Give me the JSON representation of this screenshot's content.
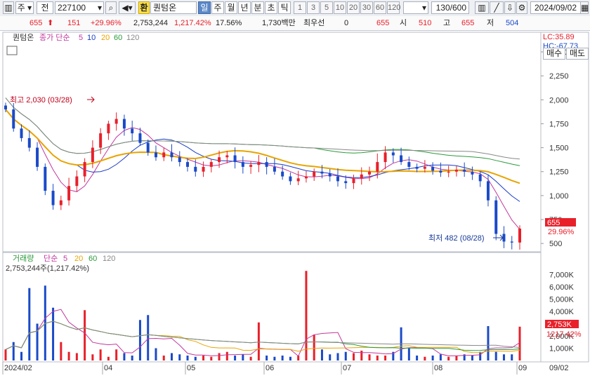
{
  "toolbar": {
    "period_short": "주",
    "prev_label": "전",
    "stock_code": "227100",
    "currency_label": "환",
    "stock_name": "퀀텀온",
    "tabs": [
      "일",
      "주",
      "월",
      "년",
      "분",
      "초",
      "틱"
    ],
    "active_tab": "일",
    "interval_buttons": [
      "1",
      "3",
      "5",
      "10",
      "20",
      "30",
      "60",
      "120"
    ],
    "count_display": "130/600",
    "date": "2024/09/02"
  },
  "info": {
    "price": "655",
    "change": "151",
    "change_pct": "+29.96%",
    "volume": "2,753,244",
    "volume_ratio": "1,217.42%",
    "turnover_pct": "17.56%",
    "amount": "1,730백만",
    "best_ask_label": "최우선",
    "best_ask_value": "0",
    "last": "655",
    "open_label": "시",
    "open": "510",
    "high_label": "고",
    "high": "655",
    "low_label": "저",
    "low": "504"
  },
  "price_panel": {
    "name_label": "퀀텀온",
    "ma_label": "종가 단순",
    "ma_periods": [
      "5",
      "10",
      "20",
      "60",
      "120"
    ],
    "lc": "LC:35.89",
    "hc": "HC:-67.73",
    "buy_button": "매수",
    "sell_button": "매도",
    "high_annotation": "최고 2,030 (03/28)",
    "low_annotation": "최저 482 (08/28)",
    "current_price_tag": "655",
    "current_pct_tag": "29.96%",
    "y_ticks": [
      "2,500",
      "2,250",
      "2,000",
      "1,750",
      "1,500",
      "1,250",
      "1,000",
      "750",
      "500"
    ]
  },
  "volume_panel": {
    "title": "거래량",
    "ma_label": "단순",
    "ma_periods": [
      "5",
      "20",
      "60",
      "120"
    ],
    "summary": "2,753,244주(1,217.42%)",
    "current_tag": "2,753K",
    "pct_tag": "1217.42%",
    "y_ticks": [
      "7,000K",
      "6,000K",
      "5,000K",
      "4,000K",
      "3,000K",
      "2,000K",
      "1,000K"
    ]
  },
  "x_axis": {
    "labels": [
      "2024/02",
      "04",
      "05",
      "06",
      "07",
      "08",
      "09"
    ],
    "right_label": "09/02"
  },
  "colors": {
    "up": "#e8202a",
    "down": "#1a4ac8",
    "ma5": "#c2389e",
    "ma10": "#1a3cc8",
    "ma20": "#e8a400",
    "ma60": "#2a9a3a",
    "ma120": "#888888"
  },
  "chart_data": {
    "type": "candlestick",
    "x_range": [
      "2024/02",
      "2024/09/02"
    ],
    "y_range_price": [
      450,
      2500
    ],
    "y_range_volume": [
      0,
      8000000
    ],
    "series": [
      {
        "name": "종가 단순 5"
      },
      {
        "name": "10"
      },
      {
        "name": "20"
      },
      {
        "name": "60"
      },
      {
        "name": "120"
      }
    ],
    "annotations": [
      {
        "label": "최고 2,030 (03/28)",
        "value": 2030
      },
      {
        "label": "최저 482 (08/28)",
        "value": 482
      }
    ],
    "close_path": [
      1900,
      1700,
      1600,
      1500,
      1300,
      1050,
      900,
      950,
      1100,
      1200,
      1350,
      1500,
      1650,
      1750,
      1800,
      1700,
      1650,
      1550,
      1450,
      1400,
      1450,
      1400,
      1350,
      1300,
      1250,
      1300,
      1350,
      1400,
      1420,
      1350,
      1300,
      1320,
      1350,
      1300,
      1250,
      1200,
      1150,
      1180,
      1200,
      1250,
      1230,
      1200,
      1150,
      1130,
      1180,
      1220,
      1250,
      1350,
      1450,
      1420,
      1350,
      1300,
      1280,
      1300,
      1260,
      1240,
      1250,
      1270,
      1250,
      1220,
      1150,
      950,
      600,
      520,
      510,
      655
    ],
    "volume_bars": [
      900000,
      1500000,
      700000,
      5900000,
      3000000,
      6100000,
      4300000,
      1500000,
      700000,
      600000,
      4100000,
      500000,
      900000,
      300000,
      900000,
      600000,
      400000,
      3300000,
      3700000,
      1000000,
      400000,
      600000,
      500000,
      400000,
      300000,
      400000,
      300000,
      600000,
      700000,
      400000,
      500000,
      300000,
      3100000,
      400000,
      300000,
      400000,
      300000,
      400000,
      7300000,
      2100000,
      900000,
      500000,
      600000,
      700000,
      600000,
      800000,
      500000,
      400000,
      400000,
      700000,
      2700000,
      1000000,
      400000,
      300000,
      400000,
      500000,
      300000,
      400000,
      500000,
      400000,
      700000,
      2800000,
      700000,
      500000,
      500000,
      2753244
    ]
  }
}
